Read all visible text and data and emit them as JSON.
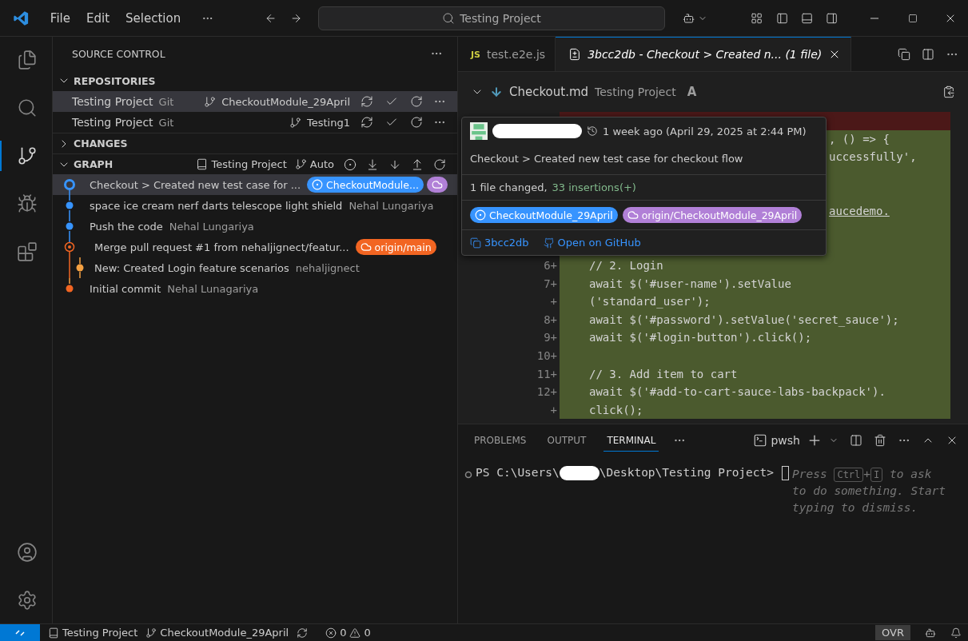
{
  "title_bar": {
    "menu": [
      "File",
      "Edit",
      "Selection"
    ],
    "search": "Testing Project"
  },
  "sidebar": {
    "title": "SOURCE CONTROL",
    "repositories": {
      "label": "REPOSITORIES",
      "expanded": true,
      "items": [
        {
          "name": "Testing Project",
          "provider": "Git",
          "branch": "CheckoutModule_29April",
          "selected": true
        },
        {
          "name": "Testing Project",
          "provider": "Git",
          "branch": "Testing1",
          "selected": false
        }
      ]
    },
    "changes": {
      "label": "CHANGES",
      "expanded": false
    },
    "graph": {
      "label": "GRAPH",
      "expanded": true,
      "repository": "Testing Project",
      "branch_filter": "Auto",
      "commits": [
        {
          "message": "Checkout > Created new test case for ...",
          "kind": "head",
          "side_branch": false,
          "color": "#3794ff",
          "selected": true,
          "refs": [
            {
              "kind": "local",
              "label": "CheckoutModule...",
              "color": "#3794ff"
            },
            {
              "kind": "remote",
              "color": "#b180d7"
            }
          ]
        },
        {
          "message": "space ice cream nerf darts telescope light shield",
          "author": "Nehal Lungariya",
          "kind": "commit",
          "side_branch": false,
          "color": "#3794ff",
          "selected": false
        },
        {
          "message": "Push the code",
          "author": "Nehal Lungariya",
          "kind": "commit",
          "side_branch": false,
          "color": "#3794ff",
          "selected": false
        },
        {
          "message": "Merge pull request #1 from nehaljignect/featur...",
          "kind": "merge",
          "side_branch": false,
          "color": "#f26522",
          "selected": false,
          "refs": [
            {
              "kind": "remote",
              "label": "origin/main",
              "color": "#f26522"
            }
          ]
        },
        {
          "message": "New: Created Login feature scenarios",
          "author": "nehaljignect",
          "kind": "commit",
          "side_branch": true,
          "color": "#f5a142",
          "selected": false
        },
        {
          "message": "Initial commit",
          "author": "Nehal Lunagariya",
          "kind": "commit",
          "side_branch": false,
          "color": "#f26522",
          "selected": false
        }
      ]
    }
  },
  "editor": {
    "tabs": [
      {
        "label": "test.e2e.js",
        "kind": "js",
        "icon_text": "JS",
        "selected": false
      },
      {
        "label": "3bcc2db - Checkout > Created n... (1 file)",
        "kind": "diff",
        "selected": true
      }
    ],
    "file": {
      "name": "Checkout.md",
      "folder": "Testing Project",
      "status": "A"
    },
    "lines": [
      {
        "kind": "removed",
        "covered": true
      },
      {
        "kind": "added",
        "covered": true,
        "text": ", () => {"
      },
      {
        "kind": "added",
        "covered": true,
        "text": "uccessfully',"
      },
      {
        "kind": "added",
        "covered": true
      },
      {
        "kind": "added",
        "covered": true
      },
      {
        "kind": "added",
        "covered": true,
        "text": "aucedemo.",
        "link": true
      },
      {
        "kind": "added",
        "covered": true
      },
      {
        "kind": "added",
        "covered": true
      },
      {
        "kind": "added",
        "gutter": "6+",
        "text": "// 2. Login"
      },
      {
        "kind": "added",
        "gutter": "7+",
        "text": "await $('#user-name').setValue"
      },
      {
        "kind": "added",
        "gutter": "+",
        "text": "('standard_user');"
      },
      {
        "kind": "added",
        "gutter": "8+",
        "text": "await $('#password').setValue('secret_sauce');"
      },
      {
        "kind": "added",
        "gutter": "9+",
        "text": "await $('#login-button').click();"
      },
      {
        "kind": "added",
        "gutter": "10+"
      },
      {
        "kind": "added",
        "gutter": "11+",
        "text": "// 3. Add item to cart"
      },
      {
        "kind": "added",
        "gutter": "12+",
        "text": "await $('#add-to-cart-sauce-labs-backpack')."
      },
      {
        "kind": "added",
        "gutter": "+",
        "text": "click();"
      }
    ]
  },
  "hover": {
    "time": "1 week ago (April 29, 2025 at 2:44 PM)",
    "message": "Checkout > Created new test case for checkout flow",
    "files_changed": "1 file changed,",
    "insertions": "33 insertions(+)",
    "refs": [
      {
        "kind": "local",
        "label": "CheckoutModule_29April",
        "color": "#3794ff"
      },
      {
        "kind": "remote",
        "label": "origin/CheckoutModule_29April",
        "color": "#b180d7"
      }
    ],
    "sha": "3bcc2db",
    "link": "Open on GitHub"
  },
  "panel": {
    "tabs": [
      {
        "label": "PROBLEMS",
        "selected": false
      },
      {
        "label": "OUTPUT",
        "selected": false
      },
      {
        "label": "TERMINAL",
        "selected": true
      }
    ],
    "shell": "pwsh",
    "prompt_before": "PS C:\\Users\\",
    "prompt_after": "\\Desktop\\Testing Project>",
    "hint": {
      "before": "Press",
      "keys": [
        "Ctrl",
        "I"
      ],
      "plus": "+",
      "after": "to ask to do something. Start typing to dismiss."
    }
  },
  "status_bar": {
    "repository": "Testing Project",
    "branch": "CheckoutModule_29April",
    "errors": "0",
    "warnings": "0",
    "mode": "OVR"
  }
}
